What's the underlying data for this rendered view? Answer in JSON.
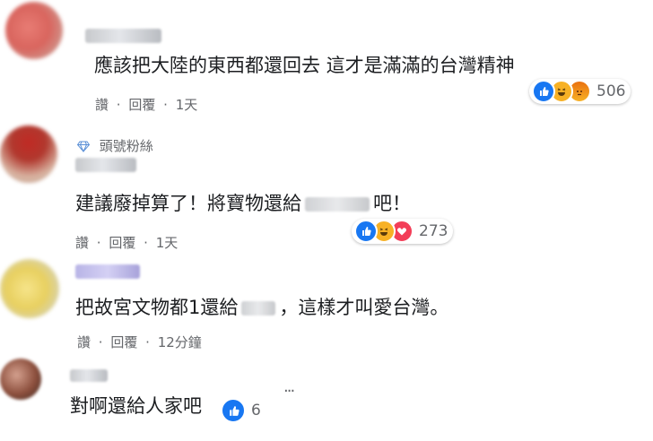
{
  "colors": {
    "like_blue": "#1877f2",
    "haha_yellow": "#f7b125",
    "angry_red": "#e9710f",
    "love_red": "#f33e58",
    "meta_gray": "#65676b",
    "text": "#1c1e21"
  },
  "comments": [
    {
      "text": "應該把大陸的東西都還回去 這才是滿滿的台灣精神",
      "meta": {
        "read": "讚",
        "reply": "回覆",
        "time": "1天"
      },
      "reactions": {
        "icons": [
          "like-icon",
          "haha-icon",
          "angry-icon"
        ],
        "count": "506"
      }
    },
    {
      "badge": "頭號粉絲",
      "text_before": "建議廢掉算了！將寶物還給",
      "text_after": "吧！",
      "meta": {
        "read": "讚",
        "reply": "回覆",
        "time": "1天"
      },
      "reactions": {
        "icons": [
          "like-icon",
          "haha-icon",
          "love-icon"
        ],
        "count": "273"
      }
    },
    {
      "text_before": "把故宮文物都1還給",
      "text_after": "，這樣才叫愛台灣。",
      "meta": {
        "read": "讚",
        "reply": "回覆",
        "time": "12分鐘"
      }
    },
    {
      "text": "對啊還給人家吧",
      "reactions": {
        "icons": [
          "like-icon"
        ],
        "count": "6"
      },
      "more": "···"
    }
  ],
  "separator": "·"
}
